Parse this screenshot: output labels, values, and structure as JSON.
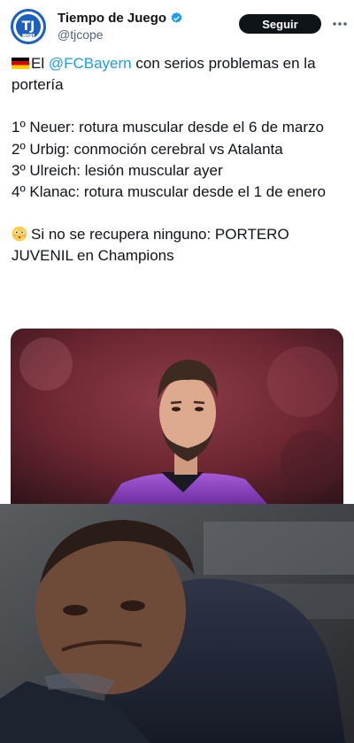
{
  "tweet": {
    "author_name": "Tiempo de Juego",
    "author_handle": "@tjcope",
    "avatar_text": "TJ",
    "avatar_subtext": "COPE",
    "follow_label": "Seguir",
    "line1_pre": "El ",
    "mention": "@FCBayern",
    "line1_post": " con serios problemas en la portería",
    "items": [
      "1º Neuer: rotura muscular desde el 6 de marzo",
      "2º Urbig: conmoción cerebral vs Atalanta",
      "3º Ulreich: lesión muscular ayer",
      "4º Klanac: rotura muscular desde el 1 de enero"
    ],
    "closing": "Si no se recupera ninguno: PORTERO JUVENIL en Champions"
  },
  "icons": {
    "verified": "verified-badge-icon",
    "more": "more-options-icon",
    "flag": "germany-flag-icon",
    "emoji": "flushed-face-icon"
  },
  "colors": {
    "accent": "#1d9bf0",
    "follow_button": "#0f1419",
    "avatar_brand": "#1d5fbf",
    "goalkeeper_jersey": "#8a3fc0"
  }
}
